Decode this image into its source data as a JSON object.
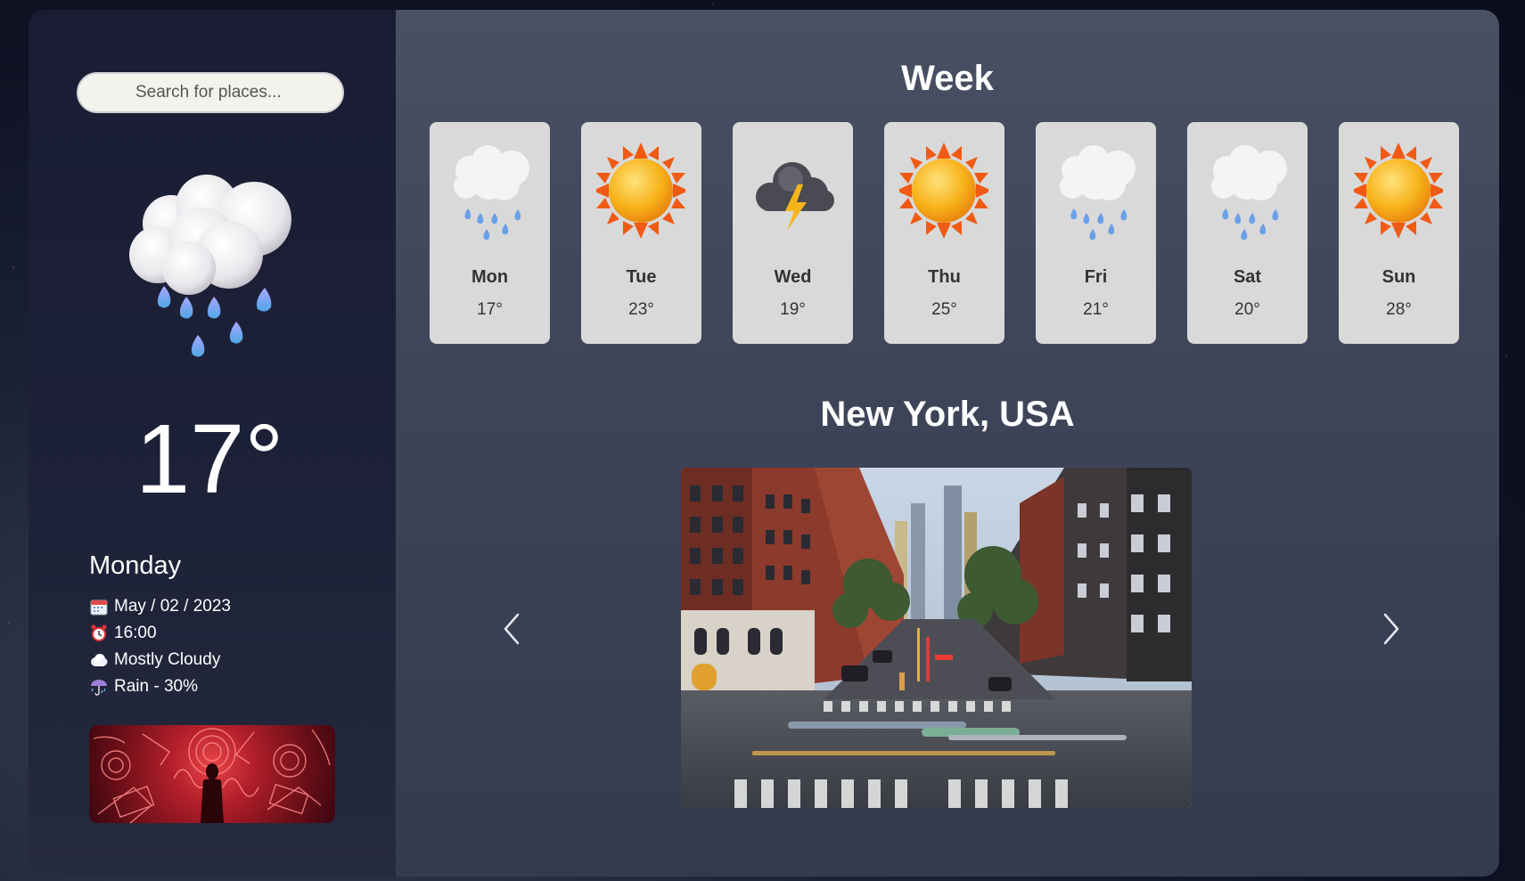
{
  "sidebar": {
    "search_placeholder": "Search for places...",
    "current_icon": "rain-cloud-icon",
    "temperature": "17°",
    "day": "Monday",
    "date": "May / 02 / 2023",
    "time": "16:00",
    "condition": "Mostly Cloudy",
    "rain": "Rain - 30%"
  },
  "main": {
    "week_title": "Week",
    "days": [
      {
        "day": "Mon",
        "temp": "17°",
        "icon": "rain-cloud-icon"
      },
      {
        "day": "Tue",
        "temp": "23°",
        "icon": "sun-icon"
      },
      {
        "day": "Wed",
        "temp": "19°",
        "icon": "thunderstorm-icon"
      },
      {
        "day": "Thu",
        "temp": "25°",
        "icon": "sun-icon"
      },
      {
        "day": "Fri",
        "temp": "21°",
        "icon": "rain-cloud-icon"
      },
      {
        "day": "Sat",
        "temp": "20°",
        "icon": "rain-cloud-icon"
      },
      {
        "day": "Sun",
        "temp": "28°",
        "icon": "sun-icon"
      }
    ],
    "city": "New York, USA"
  },
  "colors": {
    "card_bg": "#d9d9d9",
    "sidebar_bg": "#1c2036",
    "main_bg": "#41475b"
  }
}
